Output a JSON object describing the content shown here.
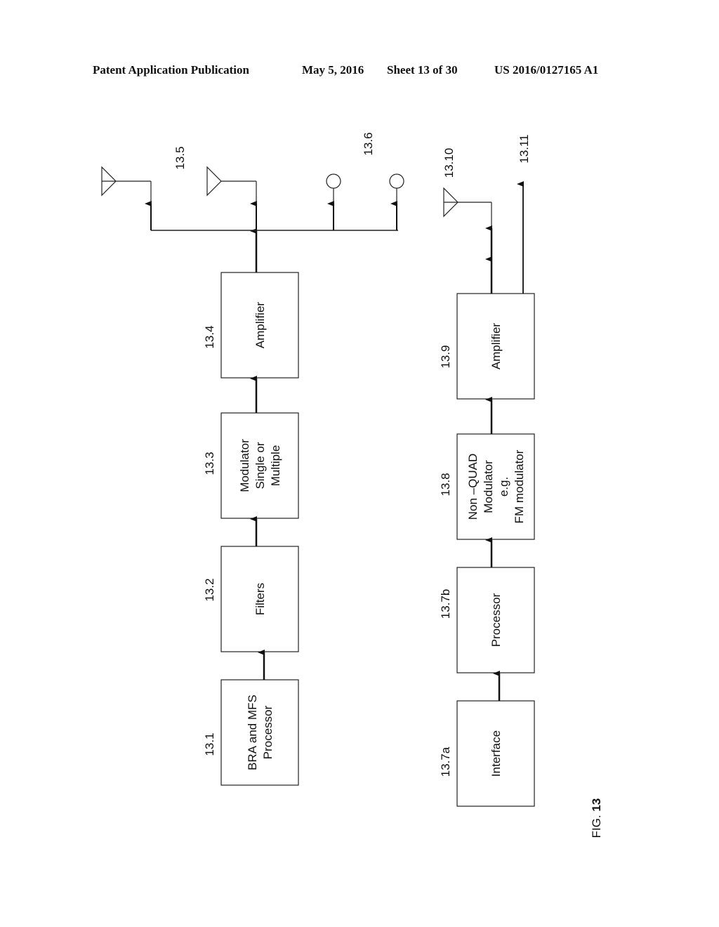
{
  "header": {
    "publication": "Patent Application Publication",
    "date": "May 5, 2016",
    "sheet": "Sheet 13 of 30",
    "number": "US 2016/0127165 A1"
  },
  "figure": {
    "label_prefix": "FIG. ",
    "label_number": "13"
  },
  "top_chain": [
    {
      "ref": "13.1",
      "lines": [
        "BRA and MFS",
        "Processor"
      ]
    },
    {
      "ref": "13.2",
      "lines": [
        "Filters"
      ]
    },
    {
      "ref": "13.3",
      "lines": [
        "Modulator",
        "Single or",
        "Multiple"
      ]
    },
    {
      "ref": "13.4",
      "lines": [
        "Amplifier"
      ]
    }
  ],
  "bottom_chain": [
    {
      "ref": "13.7a",
      "lines": [
        "Interface"
      ]
    },
    {
      "ref": "13.7b",
      "lines": [
        "Processor"
      ]
    },
    {
      "ref": "13.8",
      "lines": [
        "Non –QUAD",
        "Modulator",
        "e.g.",
        "FM modulator"
      ]
    },
    {
      "ref": "13.9",
      "lines": [
        "Amplifier"
      ]
    }
  ],
  "outputs": {
    "antennas_top_ref": "13.5",
    "circles_ref": "13.6",
    "antenna_bottom_ref": "13.10",
    "line_out_ref": "13.11"
  }
}
